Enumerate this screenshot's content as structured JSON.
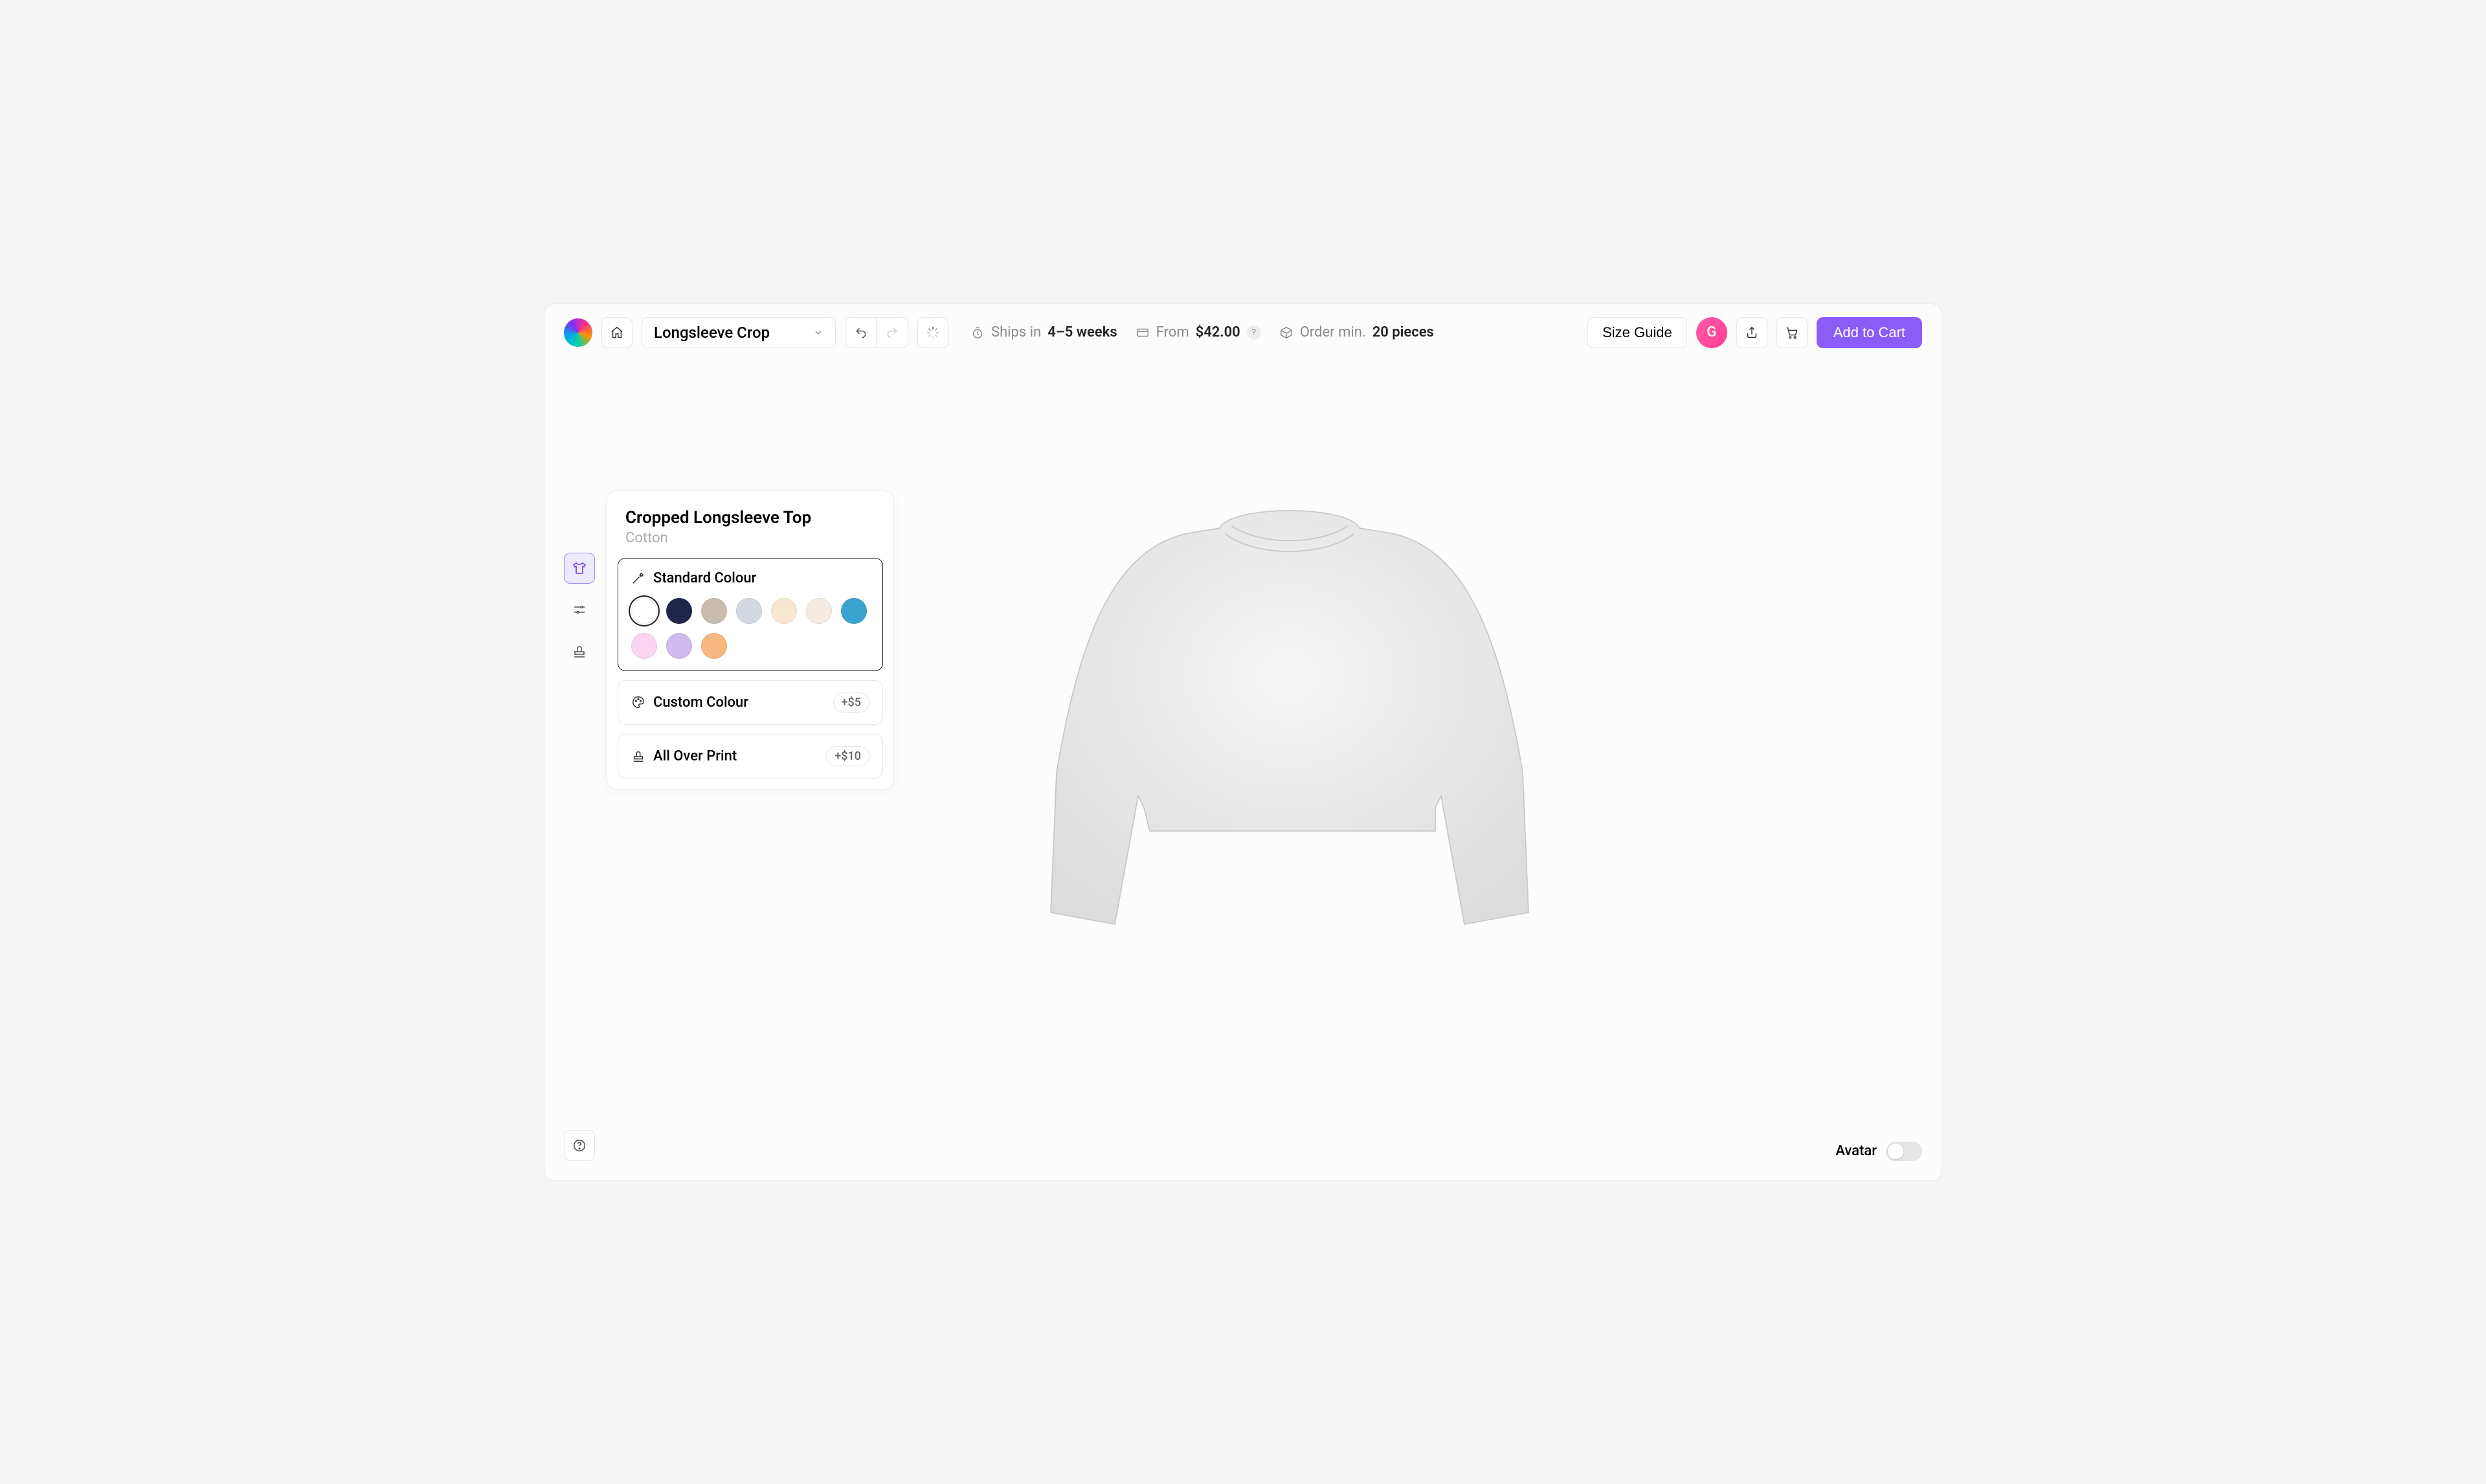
{
  "toolbar": {
    "product_name": "Longsleeve Crop",
    "ships_in_label": "Ships in",
    "ships_in_value": "4–5 weeks",
    "from_label": "From",
    "from_price": "$42.00",
    "order_min_label": "Order min.",
    "order_min_value": "20 pieces",
    "size_guide_label": "Size Guide",
    "avatar_initial": "G",
    "cta_label": "Add to Cart"
  },
  "panel": {
    "title": "Cropped Longsleeve Top",
    "subtitle": "Cotton",
    "standard_label": "Standard Colour",
    "custom_label": "Custom Colour",
    "custom_price": "+$5",
    "aop_label": "All Over Print",
    "aop_price": "+$10",
    "swatches": [
      {
        "color": "#ffffff",
        "selected": true
      },
      {
        "color": "#1e2749",
        "selected": false
      },
      {
        "color": "#c7bcae",
        "selected": false
      },
      {
        "color": "#d4d8e0",
        "selected": false
      },
      {
        "color": "#f9e8d0",
        "selected": false
      },
      {
        "color": "#f5ebe0",
        "selected": false
      },
      {
        "color": "#3ba3d0",
        "selected": false
      },
      {
        "color": "#f9d5f0",
        "selected": false
      },
      {
        "color": "#cfbaf0",
        "selected": false
      },
      {
        "color": "#f8b77e",
        "selected": false
      }
    ]
  },
  "footer": {
    "avatar_label": "Avatar"
  }
}
